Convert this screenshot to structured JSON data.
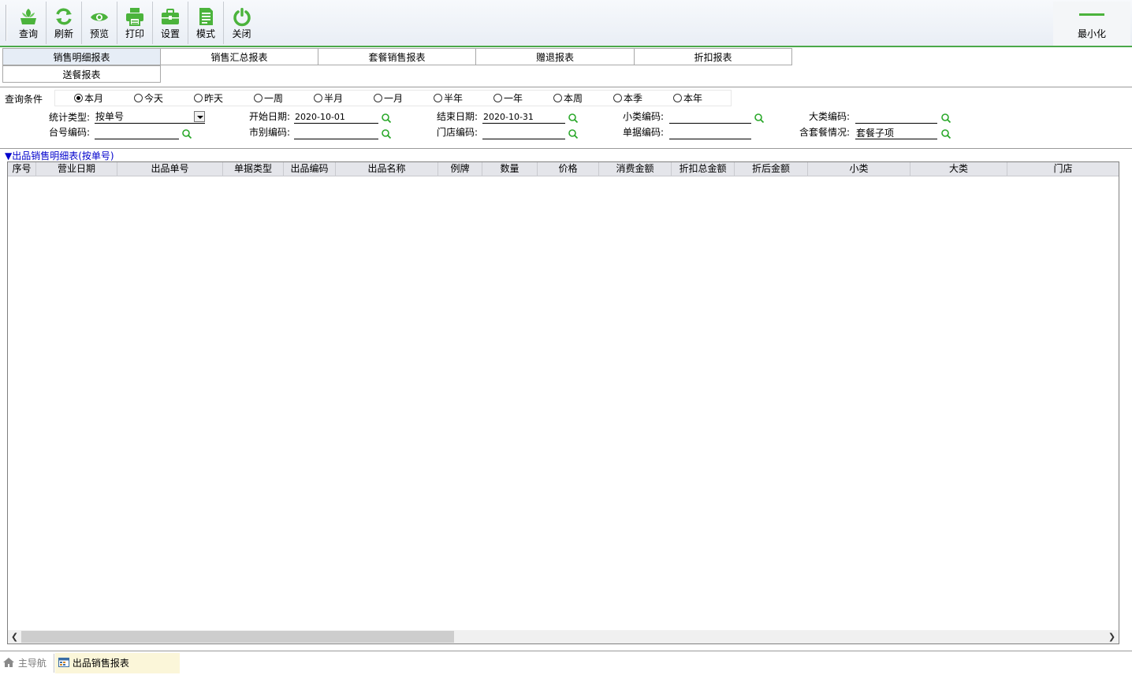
{
  "toolbar": {
    "buttons": [
      {
        "label": "查询",
        "icon": "query-icon"
      },
      {
        "label": "刷新",
        "icon": "refresh-icon"
      },
      {
        "label": "预览",
        "icon": "eye-icon"
      },
      {
        "label": "打印",
        "icon": "printer-icon"
      },
      {
        "label": "设置",
        "icon": "briefcase-icon"
      },
      {
        "label": "模式",
        "icon": "document-icon"
      },
      {
        "label": "关闭",
        "icon": "power-icon"
      }
    ],
    "minimize_label": "最小化",
    "accent_color": "#4bb33c"
  },
  "report_tabs": [
    {
      "label": "销售明细报表",
      "active": true
    },
    {
      "label": "销售汇总报表",
      "active": false
    },
    {
      "label": "套餐销售报表",
      "active": false
    },
    {
      "label": "赠退报表",
      "active": false
    },
    {
      "label": "折扣报表",
      "active": false
    },
    {
      "label": "送餐报表",
      "active": false
    }
  ],
  "query": {
    "title": "查询条件",
    "periods": [
      {
        "label": "本月",
        "checked": true
      },
      {
        "label": "今天",
        "checked": false
      },
      {
        "label": "昨天",
        "checked": false
      },
      {
        "label": "一周",
        "checked": false
      },
      {
        "label": "半月",
        "checked": false
      },
      {
        "label": "一月",
        "checked": false
      },
      {
        "label": "半年",
        "checked": false
      },
      {
        "label": "一年",
        "checked": false
      },
      {
        "label": "本周",
        "checked": false
      },
      {
        "label": "本季",
        "checked": false
      },
      {
        "label": "本年",
        "checked": false
      }
    ],
    "stat_type": {
      "label": "统计类型:",
      "value": "按单号"
    },
    "start_date": {
      "label": "开始日期:",
      "value": "2020-10-01"
    },
    "end_date": {
      "label": "结束日期:",
      "value": "2020-10-31"
    },
    "subcategory_code": {
      "label": "小类编码:",
      "value": ""
    },
    "category_code": {
      "label": "大类编码:",
      "value": ""
    },
    "table_code": {
      "label": "台号编码:",
      "value": ""
    },
    "currency_code": {
      "label": "市别编码:",
      "value": ""
    },
    "store_code": {
      "label": "门店编码:",
      "value": ""
    },
    "bill_code": {
      "label": "单据编码:",
      "value": ""
    },
    "package_status": {
      "label": "含套餐情况:",
      "value": "套餐子项"
    }
  },
  "grid": {
    "title": "▼出品销售明细表(按单号)",
    "columns": [
      "序号",
      "营业日期",
      "出品单号",
      "单据类型",
      "出品编码",
      "出品名称",
      "例牌",
      "数量",
      "价格",
      "消费金额",
      "折扣总金额",
      "折后金额",
      "小类",
      "大类",
      "门店"
    ],
    "rows": []
  },
  "bottom_nav": {
    "home_label": "主导航",
    "current_tab": "出品销售报表"
  }
}
